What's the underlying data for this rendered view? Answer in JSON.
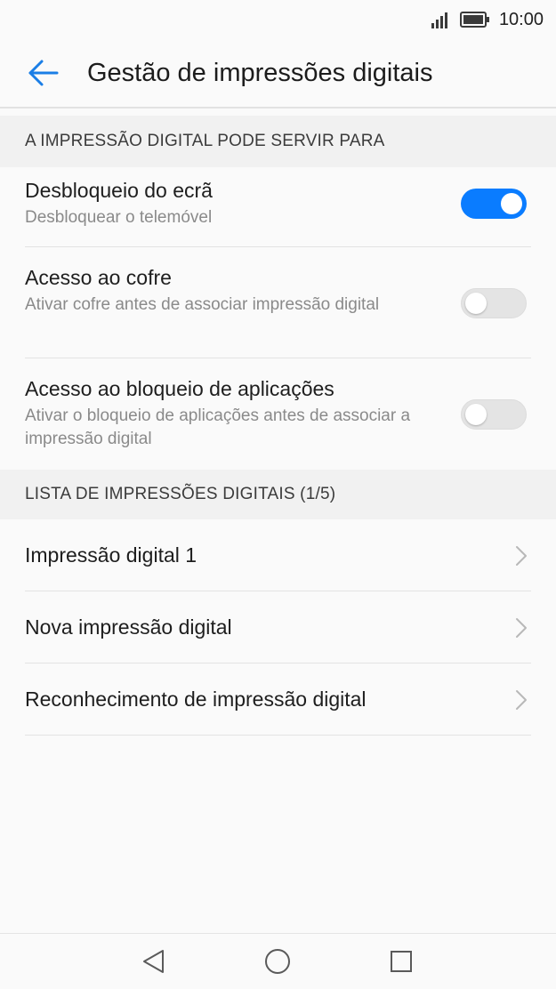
{
  "status_bar": {
    "time": "10:00",
    "icons": [
      "signal-icon",
      "battery-icon"
    ]
  },
  "app_bar": {
    "title": "Gestão de impressões digitais",
    "back_icon": "arrow-left-icon",
    "accent_color": "#1a7ee6"
  },
  "sections": {
    "usage_header": "A IMPRESSÃO DIGITAL PODE SERVIR PARA",
    "list_header": "LISTA DE IMPRESSÕES DIGITAIS (1/5)"
  },
  "toggles": [
    {
      "title": "Desbloqueio do ecrã",
      "subtitle": "Desbloquear o telemóvel",
      "enabled": true
    },
    {
      "title": "Acesso ao cofre",
      "subtitle": "Ativar cofre antes de associar impressão digital",
      "enabled": false
    },
    {
      "title": "Acesso ao bloqueio de aplicações",
      "subtitle": "Ativar o bloqueio de aplicações antes de associar a impressão digital",
      "enabled": false
    }
  ],
  "fingerprint_list": [
    {
      "label": "Impressão digital 1",
      "icon": "chevron-right-icon"
    },
    {
      "label": "Nova impressão digital",
      "icon": "chevron-right-icon"
    },
    {
      "label": "Reconhecimento de impressão digital",
      "icon": "chevron-right-icon"
    }
  ],
  "nav_bar": {
    "buttons": [
      "back-triangle-icon",
      "home-circle-icon",
      "recents-square-icon"
    ]
  },
  "colors": {
    "switch_on": "#0a7cff",
    "switch_off": "#e4e4e4",
    "section_bg": "#f1f1f1"
  }
}
